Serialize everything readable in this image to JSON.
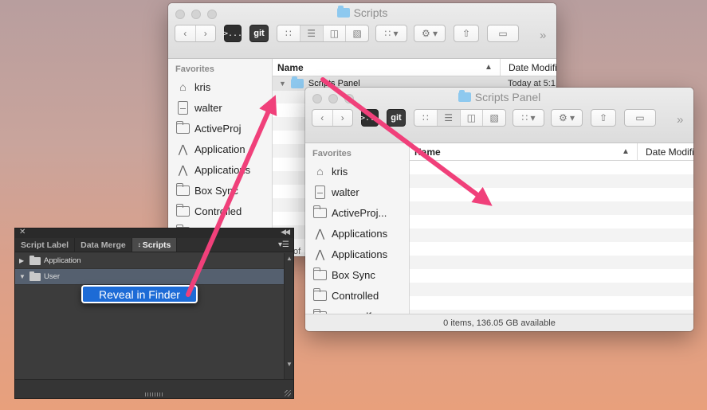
{
  "finder_back": {
    "title": "Scripts",
    "toolbar": {
      "terminal_label": ">...",
      "git_label": "git",
      "more_label": "»"
    },
    "sidebar": {
      "heading": "Favorites",
      "items": [
        {
          "label": "kris",
          "icon": "home-icon"
        },
        {
          "label": "walter",
          "icon": "drive-icon"
        },
        {
          "label": "ActiveProj",
          "icon": "folder-icon"
        },
        {
          "label": "Application",
          "icon": "applications-icon"
        },
        {
          "label": "Applications",
          "icon": "applications-icon"
        },
        {
          "label": "Box Sync",
          "icon": "folder-icon"
        },
        {
          "label": "Controlled",
          "icon": "folder-icon"
        },
        {
          "label": "cups-pdf",
          "icon": "folder-icon"
        }
      ]
    },
    "columns": {
      "name": "Name",
      "date": "Date Modifi"
    },
    "rows": [
      {
        "name": "Scripts Panel",
        "date": "Today at 5:1"
      }
    ],
    "status_fragment": "of"
  },
  "finder_front": {
    "title": "Scripts Panel",
    "toolbar": {
      "terminal_label": ">...",
      "git_label": "git",
      "more_label": "»"
    },
    "sidebar": {
      "heading": "Favorites",
      "items": [
        {
          "label": "kris",
          "icon": "home-icon"
        },
        {
          "label": "walter",
          "icon": "drive-icon"
        },
        {
          "label": "ActiveProj...",
          "icon": "folder-icon"
        },
        {
          "label": "Applications",
          "icon": "applications-icon"
        },
        {
          "label": "Applications",
          "icon": "applications-icon"
        },
        {
          "label": "Box Sync",
          "icon": "folder-icon"
        },
        {
          "label": "Controlled",
          "icon": "folder-icon"
        },
        {
          "label": "cups-pdf",
          "icon": "folder-icon"
        }
      ]
    },
    "columns": {
      "name": "Name",
      "date": "Date Modifi"
    },
    "status": "0 items, 136.05 GB available"
  },
  "scripts_panel": {
    "tabs": [
      "Script Label",
      "Data Merge",
      "Scripts"
    ],
    "active_tab": "Scripts",
    "tree": [
      {
        "label": "Application",
        "expanded": false
      },
      {
        "label": "User",
        "expanded": true
      }
    ],
    "context_menu": {
      "item": "Reveal in Finder"
    }
  },
  "colors": {
    "arrow": "#f0407a",
    "menu_highlight": "#1d6bd6",
    "folder_blue": "#8ec9ef"
  }
}
